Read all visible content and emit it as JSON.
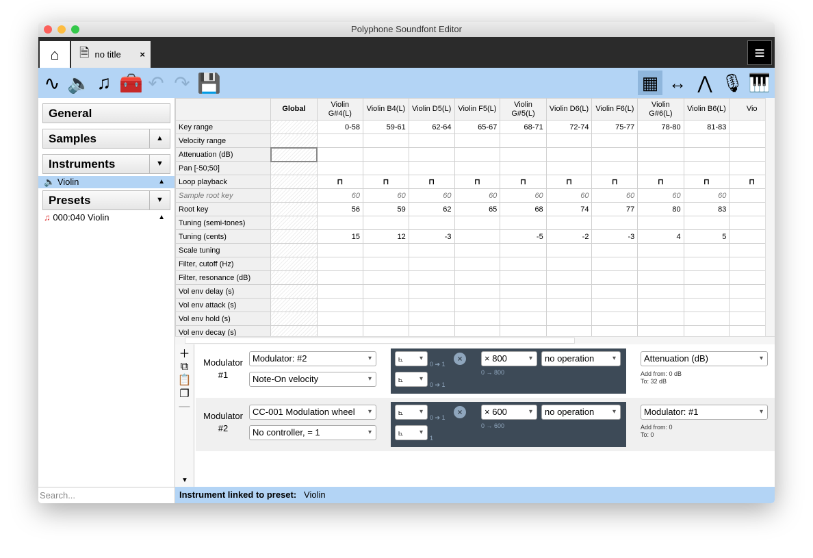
{
  "window": {
    "title": "Polyphone Soundfont Editor"
  },
  "tabs": {
    "doc_title": "no title",
    "close": "×"
  },
  "toolbar": {
    "icons": [
      "sample-wave-icon",
      "speaker-icon",
      "music-note-icon",
      "toolbox-icon",
      "undo-icon",
      "redo-icon",
      "save-icon"
    ],
    "right_icons": [
      "table-view-icon",
      "range-icon",
      "envelope-icon",
      "microphone-icon",
      "piano-icon"
    ]
  },
  "sidebar": {
    "general": "General",
    "samples": "Samples",
    "instruments": "Instruments",
    "instrument_item": "Violin",
    "presets": "Presets",
    "preset_item": "000:040 Violin",
    "search_placeholder": "Search..."
  },
  "table": {
    "columns": [
      "Global",
      "Violin G#4(L)",
      "Violin B4(L)",
      "Violin D5(L)",
      "Violin F5(L)",
      "Violin G#5(L)",
      "Violin D6(L)",
      "Violin F6(L)",
      "Violin G#6(L)",
      "Violin B6(L)",
      "Vio"
    ],
    "rows": [
      {
        "label": "Key range",
        "values": [
          "",
          "0-58",
          "59-61",
          "62-64",
          "65-67",
          "68-71",
          "72-74",
          "75-77",
          "78-80",
          "81-83",
          ""
        ]
      },
      {
        "label": "Velocity range",
        "values": [
          "",
          "",
          "",
          "",
          "",
          "",
          "",
          "",
          "",
          "",
          ""
        ]
      },
      {
        "label": "Attenuation (dB)",
        "values": [
          "",
          "",
          "",
          "",
          "",
          "",
          "",
          "",
          "",
          "",
          ""
        ]
      },
      {
        "label": "Pan [-50;50]",
        "values": [
          "",
          "",
          "",
          "",
          "",
          "",
          "",
          "",
          "",
          "",
          ""
        ]
      },
      {
        "label": "Loop playback",
        "values": [
          "",
          "loop",
          "loop",
          "loop",
          "loop",
          "loop",
          "loop",
          "loop",
          "loop",
          "loop",
          "loop"
        ]
      },
      {
        "label": "Sample root key",
        "values": [
          "",
          "60",
          "60",
          "60",
          "60",
          "60",
          "60",
          "60",
          "60",
          "60",
          ""
        ]
      },
      {
        "label": "Root key",
        "values": [
          "",
          "56",
          "59",
          "62",
          "65",
          "68",
          "74",
          "77",
          "80",
          "83",
          ""
        ]
      },
      {
        "label": "Tuning (semi-tones)",
        "values": [
          "",
          "",
          "",
          "",
          "",
          "",
          "",
          "",
          "",
          "",
          ""
        ]
      },
      {
        "label": "Tuning (cents)",
        "values": [
          "",
          "15",
          "12",
          "-3",
          "",
          "-5",
          "-2",
          "-3",
          "4",
          "5",
          ""
        ]
      },
      {
        "label": "Scale tuning",
        "values": [
          "",
          "",
          "",
          "",
          "",
          "",
          "",
          "",
          "",
          "",
          ""
        ]
      },
      {
        "label": "Filter, cutoff (Hz)",
        "values": [
          "",
          "",
          "",
          "",
          "",
          "",
          "",
          "",
          "",
          "",
          ""
        ]
      },
      {
        "label": "Filter, resonance (dB)",
        "values": [
          "",
          "",
          "",
          "",
          "",
          "",
          "",
          "",
          "",
          "",
          ""
        ]
      },
      {
        "label": "Vol env delay (s)",
        "values": [
          "",
          "",
          "",
          "",
          "",
          "",
          "",
          "",
          "",
          "",
          ""
        ]
      },
      {
        "label": "Vol env attack (s)",
        "values": [
          "",
          "",
          "",
          "",
          "",
          "",
          "",
          "",
          "",
          "",
          ""
        ]
      },
      {
        "label": "Vol env hold (s)",
        "values": [
          "",
          "",
          "",
          "",
          "",
          "",
          "",
          "",
          "",
          "",
          ""
        ]
      },
      {
        "label": "Vol env decay (s)",
        "values": [
          "",
          "",
          "",
          "",
          "",
          "",
          "",
          "",
          "",
          "",
          ""
        ]
      }
    ]
  },
  "modulators": [
    {
      "label": "Modulator #1",
      "source1": "Modulator: #2",
      "source2": "Note-On velocity",
      "range1": "0 ➔ 1",
      "range2": "0 ➔ 1",
      "amount": "800",
      "amount_range": "0 → 800",
      "operation": "no operation",
      "destination": "Attenuation (dB)",
      "add_from": "Add from: 0 dB",
      "to": "To: 32 dB"
    },
    {
      "label": "Modulator #2",
      "source1": "CC-001 Modulation wheel",
      "source2": "No controller, = 1",
      "range1": "0 ➔ 1",
      "range2": "1",
      "amount": "600",
      "amount_range": "0 → 600",
      "operation": "no operation",
      "destination": "Modulator: #1",
      "add_from": "Add from: 0",
      "to": "To: 0"
    }
  ],
  "status": {
    "label": "Instrument linked to preset:",
    "value": "Violin"
  }
}
